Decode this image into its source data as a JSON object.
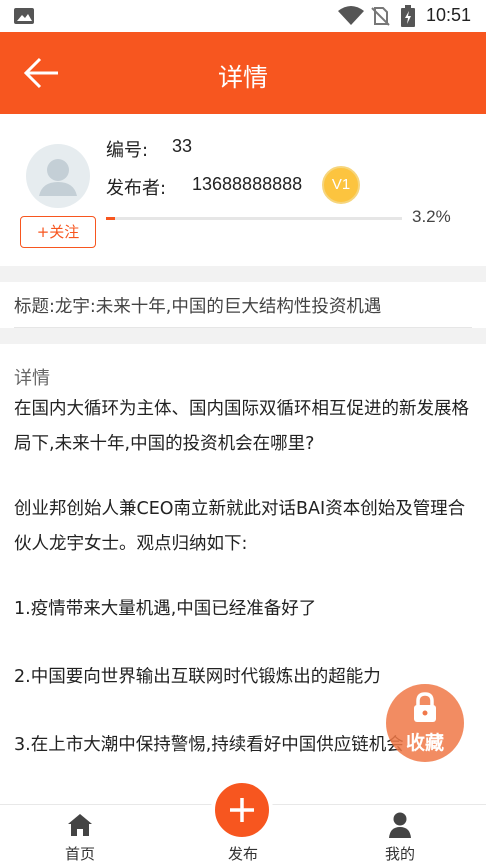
{
  "status_bar": {
    "time": "10:51"
  },
  "header": {
    "title": "详情",
    "back_icon": "arrow-left-icon"
  },
  "profile": {
    "id_label": "编号:",
    "id_value": "33",
    "publisher_label": "发布者:",
    "publisher_value": "13688888888",
    "level_badge": "V1",
    "follow_label": "+关注",
    "progress_percent": 3.2,
    "progress_text": "3.2%"
  },
  "title_row": {
    "text": "标题:龙宇:未来十年,中国的巨大结构性投资机遇"
  },
  "detail": {
    "heading": "详情",
    "paragraphs": [
      "在国内大循环为主体、国内国际双循环相互促进的新发展格局下,未来十年,中国的投资机会在哪里?",
      "创业邦创始人兼CEO南立新就此对话BAI资本创始及管理合伙人龙宇女士。观点归纳如下:",
      "1.疫情带来大量机遇,中国已经准备好了",
      "2.中国要向世界输出互联网时代锻炼出的超能力",
      "3.在上市大潮中保持警惕,持续看好中国供应链机会"
    ]
  },
  "favorite": {
    "label": "收藏"
  },
  "tabbar": {
    "home": "首页",
    "publish": "发布",
    "mine": "我的"
  },
  "colors": {
    "accent": "#f7561f",
    "badge": "#fcc43f"
  }
}
